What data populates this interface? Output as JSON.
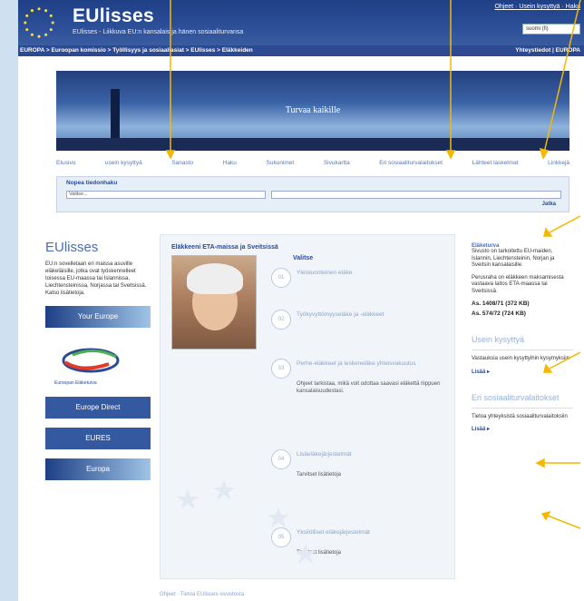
{
  "header": {
    "title": "EUlisses",
    "subtitle": "EUlisses - Liikkuva EU:n kansalais ja hänen sosiaaliturvansa",
    "top_link": "Ohjeet · Usein kysyttyä · Haku",
    "language": "suomi (fi)"
  },
  "breadcrumb": {
    "path": "EUROPA > Euroopan komissio > Työllisyys ja sosiaaliasiat > EUlisses > Eläkkeiden",
    "right": "Yhteystiedot | EUROPA"
  },
  "banner": {
    "title": "Turvaa kaikille"
  },
  "nav": [
    "Etusivu",
    "usein kysyttyä",
    "Sanasto",
    "Haku",
    "Sukunimet",
    "Sivukartta",
    "Eri sosiaaliturvalaitokset",
    "Lähteet laskelmat",
    "Linkkejä"
  ],
  "search": {
    "label": "Nopea tiedonhaku",
    "select_value": "Valitse...",
    "go": "Jatka"
  },
  "left": {
    "title": "EUlisses",
    "text": "EU:n sovelletaan eri maissa asuville eläkeläisille, jotka ovat työskennelleet toisessa EU-maassa tai Islannissa, Liechtensteinissa, Norjassa tai Sveitsissä. Katso lisätietoja.",
    "logos": [
      "Your Europe",
      "Euroopan Eläketurva",
      "Europe Direct",
      "EURES",
      "Europa"
    ]
  },
  "content": {
    "title": "Eläkkeeni ETA-maissa ja Sveitsissä",
    "choose": "Valitse",
    "items": [
      {
        "num": "01",
        "title": "Yleisluonteinen eläke",
        "desc": ""
      },
      {
        "num": "02",
        "title": "Työkyvyttömyyseläke ja -eläkkeet",
        "desc": ""
      },
      {
        "num": "03",
        "title": "Perhe-eläkkeet ja leskeneläke yhteisvakuutus",
        "desc": "Ohjeet tarkistaa, mikä voit odottaa saavasi eläkettä riippuen kansalaisuudestasi."
      },
      {
        "num": "04",
        "title": "Lisäeläkejärjestelmät",
        "desc": "Tarvitset lisätietoja"
      },
      {
        "num": "05",
        "title": "Yksilölliset eläkejärjestelmät",
        "desc": "Tarvitset lisätietoja"
      }
    ],
    "footer": "Ohjeet · Tietoa EUlisses-sivustosta"
  },
  "right": {
    "head": "Eläketurva",
    "text": "Sivusto on tarkoitettu EU-maiden, Islannin, Liechtensteinin, Norjan ja Sveitsin kansalaisille.",
    "text2": "Perusraha on eläkkeen maksamisesta vastaava laitos ETA-maassa tai Sveitsissä.",
    "law1": "As. 1408/71 (372 KB)",
    "law2": "As. 574/72 (724 KB)",
    "faq_title": "Usein kysyttyä",
    "faq_text": "Vastauksia usein kysyttyihin kysymyksiin",
    "faq_more": "Lisää ▸",
    "inst_title": "Eri sosiaaliturvalaitokset",
    "inst_text": "Tietoa yhteyksistä sosiaaliturvalaitoksiin",
    "inst_more": "Lisää ▸"
  }
}
